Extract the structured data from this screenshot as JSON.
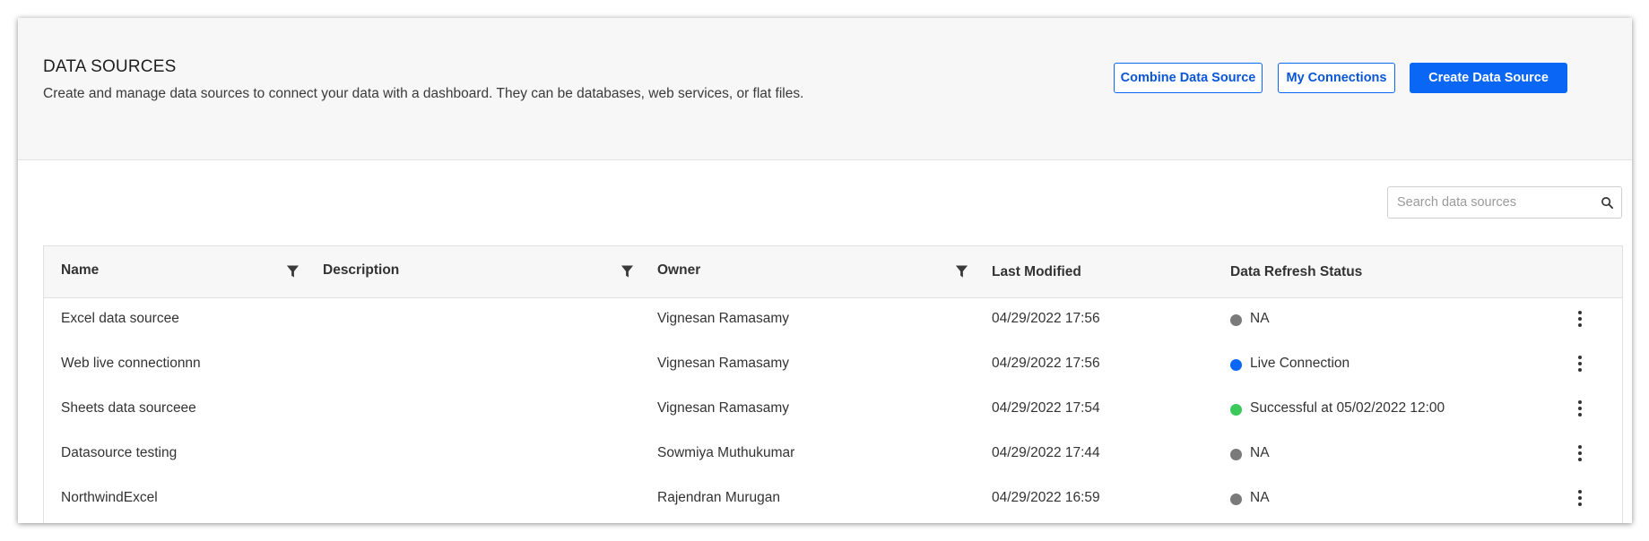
{
  "header": {
    "title": "DATA SOURCES",
    "description": "Create and manage data sources to connect your data with a dashboard. They can be databases, web services, or flat files.",
    "buttons": {
      "combine": "Combine Data Source",
      "connections": "My Connections",
      "create": "Create Data Source"
    }
  },
  "search": {
    "placeholder": "Search data sources",
    "icon": "search-icon"
  },
  "table": {
    "columns": {
      "name": "Name",
      "description": "Description",
      "owner": "Owner",
      "modified": "Last Modified",
      "status": "Data Refresh Status"
    },
    "rows": [
      {
        "name": "Excel data sourcee",
        "description": "",
        "owner": "Vignesan Ramasamy",
        "modified": "04/29/2022 17:56",
        "status": "NA",
        "status_color": "#7a7a7a"
      },
      {
        "name": "Web live connectionnn",
        "description": "",
        "owner": "Vignesan Ramasamy",
        "modified": "04/29/2022 17:56",
        "status": "Live Connection",
        "status_color": "#0a66f5"
      },
      {
        "name": "Sheets data sourceee",
        "description": "",
        "owner": "Vignesan Ramasamy",
        "modified": "04/29/2022 17:54",
        "status": "Successful at 05/02/2022 12:00",
        "status_color": "#3ac95a"
      },
      {
        "name": "Datasource testing",
        "description": "",
        "owner": "Sowmiya Muthukumar",
        "modified": "04/29/2022 17:44",
        "status": "NA",
        "status_color": "#7a7a7a"
      },
      {
        "name": "NorthwindExcel",
        "description": "",
        "owner": "Rajendran Murugan",
        "modified": "04/29/2022 16:59",
        "status": "NA",
        "status_color": "#7a7a7a"
      }
    ]
  },
  "colors": {
    "accent": "#0a66f5",
    "header_bg": "#f7f7f7"
  }
}
